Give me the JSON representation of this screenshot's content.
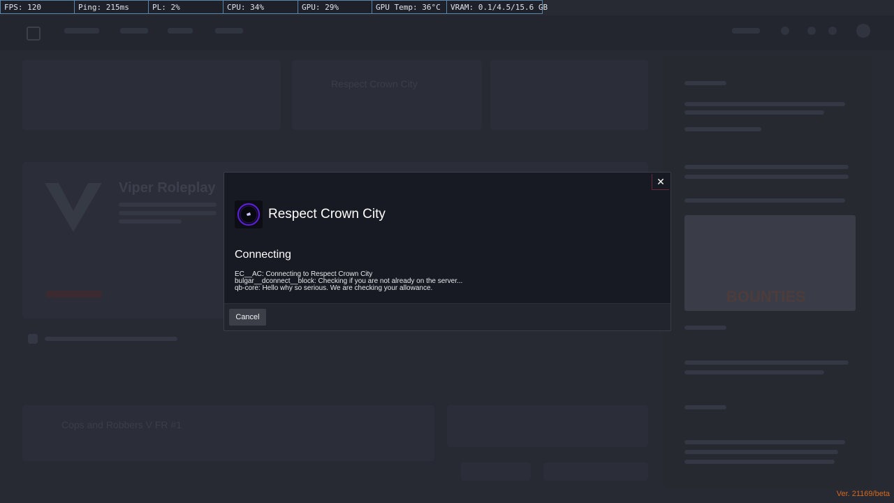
{
  "perf_overlay": {
    "items": [
      "FPS: 120",
      "Ping: 215ms",
      "PL: 2%",
      "CPU: 34%",
      "GPU: 29%",
      "GPU Temp: 36°C",
      "VRAM: 0.1/4.5/15.6 GB"
    ]
  },
  "background": {
    "featured_server_name": "Respect Crown City",
    "listed_server_name": "Viper Roleplay",
    "lower_server_name": "Cops and Robbers V FR #1",
    "promo_text": "BOUNTIES",
    "promo_subtext": "BOUNTIES"
  },
  "modal": {
    "server_name": "Respect Crown City",
    "status_title": "Connecting",
    "log_lines": [
      "EC__AC: Connecting to Respect Crown City",
      "bulgar__dconnect__block: Checking if you are not already on the server...",
      "qb-core: Hello why so serious. We are checking your allowance."
    ],
    "close_glyph": "✕",
    "cancel_label": "Cancel"
  },
  "footer": {
    "version": "Ver. 21169/beta"
  },
  "colors": {
    "accent_version": "#d5691e",
    "perf_border": "#5c86a8",
    "close_border": "#6b2a3c"
  }
}
